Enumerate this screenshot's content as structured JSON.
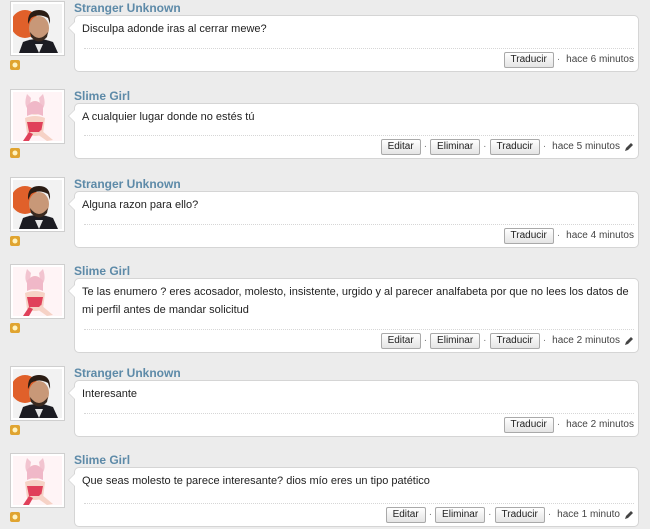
{
  "buttons": {
    "edit": "Editar",
    "delete": "Eliminar",
    "translate": "Traducir"
  },
  "separator": "·",
  "messages": [
    {
      "author": "Stranger Unknown",
      "avatar_icon": "man-portrait-avatar",
      "text": "Disculpa adonde iras al cerrar mewe?",
      "time": "hace 6 minutos",
      "own": false
    },
    {
      "author": "Slime Girl",
      "avatar_icon": "anime-girl-avatar",
      "text": "A cualquier lugar donde no estés tú",
      "time": "hace 5 minutos",
      "own": true
    },
    {
      "author": "Stranger Unknown",
      "avatar_icon": "man-portrait-avatar",
      "text": "Alguna razon para ello?",
      "time": "hace 4 minutos",
      "own": false
    },
    {
      "author": "Slime Girl",
      "avatar_icon": "anime-girl-avatar",
      "text": "Te las enumero ? eres acosador, molesto, insistente, urgido y al parecer analfabeta por que no lees los datos de mi perfil antes de mandar solicitud",
      "time": "hace 2 minutos",
      "own": true
    },
    {
      "author": "Stranger Unknown",
      "avatar_icon": "man-portrait-avatar",
      "text": "Interesante",
      "time": "hace 2 minutos",
      "own": false
    },
    {
      "author": "Slime Girl",
      "avatar_icon": "anime-girl-avatar",
      "text": "Que seas molesto te parece interesante? dios mío eres un tipo patético",
      "time": "hace 1 minuto",
      "own": true
    }
  ]
}
